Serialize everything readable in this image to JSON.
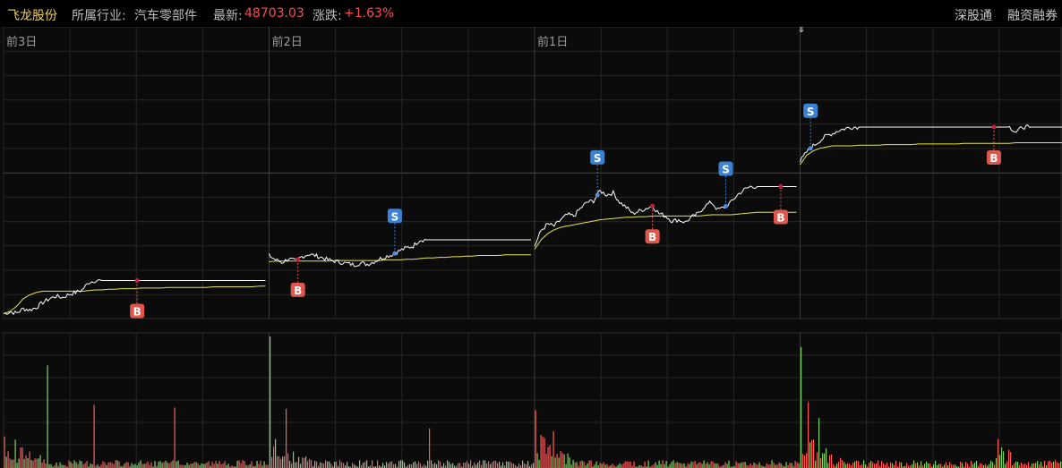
{
  "header": {
    "stock_name": "飞龙股份",
    "industry_label": "所属行业:",
    "industry_value": "汽车零部件",
    "last_label": "最新:",
    "last_value": "48703.03",
    "change_label": "涨跌:",
    "change_value": "+1.63%",
    "btn_shenzhen_connect": "深股通",
    "btn_margin": "融资融券"
  },
  "colors": {
    "price_line": "#ffffff",
    "avg_line": "#e6e64c",
    "buy_marker": "#e0564a",
    "sell_marker": "#3b82d6",
    "vol_up": "#ff5b5b",
    "vol_down": "#7fd36a",
    "grid": "#262626",
    "background": "#0b0b0b"
  },
  "chart_data": {
    "type": "line",
    "title": "",
    "days": [
      {
        "label": "前3日"
      },
      {
        "label": "前2日"
      },
      {
        "label": "前1日"
      },
      {
        "label": ""
      }
    ],
    "price": [
      [
        0.02,
        0.05,
        0.03,
        0.1,
        0.08,
        0.12,
        0.2,
        0.26,
        0.3,
        0.28,
        0.33,
        0.36,
        0.4,
        0.52,
        0.55,
        0.55,
        0.55,
        0.55,
        0.55,
        0.55,
        0.55,
        0.55,
        0.55,
        0.55,
        0.55,
        0.55,
        0.55,
        0.55,
        0.55,
        0.55,
        0.55,
        0.55,
        0.55,
        0.55,
        0.55,
        0.55,
        0.55,
        0.55,
        0.55,
        0.55,
        0.55
      ],
      [
        0.95,
        0.88,
        0.84,
        0.9,
        0.86,
        0.93,
        0.97,
        0.95,
        0.92,
        0.88,
        0.86,
        0.84,
        0.82,
        0.8,
        0.83,
        0.81,
        0.85,
        0.9,
        0.94,
        0.97,
        1.03,
        1.07,
        1.1,
        1.2,
        1.2,
        1.2,
        1.2,
        1.2,
        1.2,
        1.2,
        1.2,
        1.2,
        1.2,
        1.2,
        1.2,
        1.2,
        1.2,
        1.2,
        1.2,
        1.2,
        1.2
      ],
      [
        1.1,
        1.35,
        1.45,
        1.42,
        1.52,
        1.6,
        1.58,
        1.7,
        1.8,
        1.82,
        1.98,
        1.92,
        1.95,
        1.8,
        1.72,
        1.62,
        1.66,
        1.7,
        1.74,
        1.62,
        1.58,
        1.5,
        1.52,
        1.48,
        1.56,
        1.62,
        1.74,
        1.8,
        1.68,
        1.72,
        1.8,
        1.92,
        2.0,
        2.05,
        2.05,
        2.05,
        2.05,
        2.05,
        2.05,
        2.05,
        2.05
      ],
      [
        2.45,
        2.6,
        2.7,
        2.78,
        2.86,
        2.9,
        2.95,
        2.98,
        3.0,
        3.0,
        3.0,
        3.0,
        3.0,
        3.0,
        3.0,
        3.0,
        3.0,
        3.0,
        3.0,
        3.0,
        3.0,
        3.0,
        3.0,
        3.0,
        3.0,
        3.0,
        3.0,
        3.0,
        3.0,
        3.0,
        3.0,
        3.0,
        3.0,
        2.92,
        3.0,
        3.0,
        3.0,
        3.0,
        3.0,
        3.0,
        3.0
      ]
    ],
    "avg": [
      [
        0.02,
        0.06,
        0.14,
        0.26,
        0.32,
        0.36,
        0.38,
        0.38,
        0.38,
        0.38,
        0.38,
        0.38,
        0.38,
        0.39,
        0.4,
        0.4,
        0.41,
        0.41,
        0.42,
        0.42,
        0.42,
        0.43,
        0.43,
        0.43,
        0.43,
        0.44,
        0.44,
        0.44,
        0.44,
        0.44,
        0.44,
        0.44,
        0.45,
        0.45,
        0.45,
        0.45,
        0.45,
        0.45,
        0.45,
        0.46,
        0.46
      ],
      [
        0.85,
        0.86,
        0.86,
        0.86,
        0.86,
        0.86,
        0.86,
        0.86,
        0.86,
        0.86,
        0.87,
        0.87,
        0.87,
        0.87,
        0.87,
        0.87,
        0.87,
        0.87,
        0.88,
        0.88,
        0.88,
        0.89,
        0.89,
        0.9,
        0.91,
        0.91,
        0.92,
        0.92,
        0.93,
        0.93,
        0.94,
        0.94,
        0.95,
        0.95,
        0.95,
        0.95,
        0.96,
        0.96,
        0.96,
        0.96,
        0.96
      ],
      [
        1.05,
        1.2,
        1.3,
        1.36,
        1.4,
        1.42,
        1.44,
        1.46,
        1.48,
        1.5,
        1.52,
        1.53,
        1.54,
        1.55,
        1.56,
        1.56,
        1.57,
        1.57,
        1.58,
        1.58,
        1.58,
        1.58,
        1.58,
        1.58,
        1.58,
        1.58,
        1.59,
        1.6,
        1.6,
        1.6,
        1.6,
        1.61,
        1.62,
        1.63,
        1.64,
        1.64,
        1.64,
        1.64,
        1.64,
        1.64,
        1.64
      ],
      [
        2.4,
        2.55,
        2.62,
        2.66,
        2.68,
        2.7,
        2.7,
        2.7,
        2.7,
        2.71,
        2.71,
        2.71,
        2.71,
        2.72,
        2.72,
        2.72,
        2.72,
        2.72,
        2.73,
        2.73,
        2.73,
        2.73,
        2.73,
        2.73,
        2.73,
        2.74,
        2.74,
        2.74,
        2.74,
        2.74,
        2.74,
        2.74,
        2.74,
        2.75,
        2.75,
        2.75,
        2.75,
        2.75,
        2.75,
        2.75,
        2.75
      ]
    ],
    "markers": [
      {
        "day": 0,
        "t": 0.51,
        "type": "B",
        "label": "B"
      },
      {
        "day": 1,
        "t": 0.11,
        "type": "B",
        "label": "B"
      },
      {
        "day": 1,
        "t": 0.48,
        "type": "S",
        "label": "S"
      },
      {
        "day": 2,
        "t": 0.24,
        "type": "S",
        "label": "S"
      },
      {
        "day": 2,
        "t": 0.45,
        "type": "B",
        "label": "B"
      },
      {
        "day": 2,
        "t": 0.73,
        "type": "S",
        "label": "S"
      },
      {
        "day": 2,
        "t": 0.94,
        "type": "B",
        "label": "B"
      },
      {
        "day": 3,
        "t": 0.04,
        "type": "S",
        "label": "S"
      },
      {
        "day": 3,
        "t": 0.74,
        "type": "B",
        "label": "B"
      }
    ],
    "volume_spikes": [
      {
        "day": 0,
        "t": 0.16,
        "v": 0.78,
        "dir": "down"
      },
      {
        "day": 0,
        "t": 0.34,
        "v": 0.48,
        "dir": "up"
      },
      {
        "day": 0,
        "t": 0.64,
        "v": 0.46,
        "dir": "up"
      },
      {
        "day": 1,
        "t": 0.0,
        "v": 1.0,
        "dir": "down"
      },
      {
        "day": 1,
        "t": 0.06,
        "v": 0.45,
        "dir": "up"
      },
      {
        "day": 1,
        "t": 0.6,
        "v": 0.3,
        "dir": "up"
      },
      {
        "day": 2,
        "t": 0.0,
        "v": 0.44,
        "dir": "up"
      },
      {
        "day": 2,
        "t": 0.07,
        "v": 0.28,
        "dir": "up"
      },
      {
        "day": 3,
        "t": 0.0,
        "v": 0.92,
        "dir": "down"
      },
      {
        "day": 3,
        "t": 0.03,
        "v": 0.5,
        "dir": "up"
      },
      {
        "day": 3,
        "t": 0.07,
        "v": 0.38,
        "dir": "down"
      },
      {
        "day": 3,
        "t": 0.74,
        "v": 0.22,
        "dir": "up"
      }
    ]
  }
}
